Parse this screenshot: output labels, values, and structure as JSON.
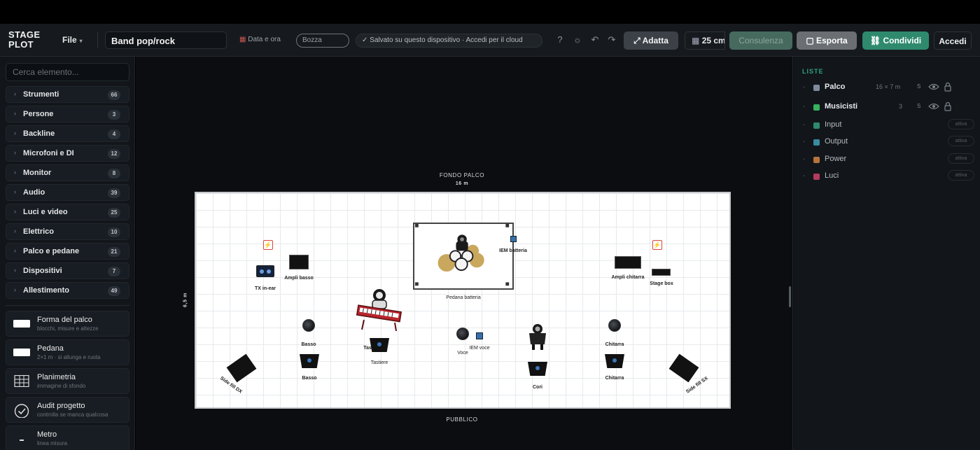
{
  "app": {
    "brand": "STAGE\nPLOT",
    "file_menu": "File",
    "project_name": "Band pop/rock"
  },
  "toolbar": {
    "date_label": "Data e ora",
    "status_draft": "Bozza",
    "saved_note": "Salvato su questo dispositivo · Accedi per il cloud",
    "fit_label": "Adatta",
    "grid_label": "25 cm",
    "consult_label": "Consulenza",
    "export_label": "Esporta",
    "share_label": "Condividi",
    "login_label": "Accedi"
  },
  "sidebar": {
    "search_placeholder": "Cerca elemento...",
    "categories": [
      {
        "label": "Strumenti",
        "count": "66"
      },
      {
        "label": "Persone",
        "count": "3"
      },
      {
        "label": "Backline",
        "count": "4"
      },
      {
        "label": "Microfoni e DI",
        "count": "12"
      },
      {
        "label": "Monitor",
        "count": "8"
      },
      {
        "label": "Audio",
        "count": "39"
      },
      {
        "label": "Luci e video",
        "count": "25"
      },
      {
        "label": "Elettrico",
        "count": "10"
      },
      {
        "label": "Palco e pedane",
        "count": "21"
      },
      {
        "label": "Dispositivi",
        "count": "7"
      },
      {
        "label": "Allestimento",
        "count": "49"
      }
    ],
    "tools": [
      {
        "name": "Forma del palco",
        "sub": "blocchi, misure e altezze"
      },
      {
        "name": "Pedana",
        "sub": "2×1 m · si allunga e ruota"
      },
      {
        "name": "Planimetria",
        "sub": "immagine di sfondo"
      },
      {
        "name": "Audit progetto",
        "sub": "controlla se manca qualcosa"
      },
      {
        "name": "Metro",
        "sub": "linea misura"
      }
    ]
  },
  "stage": {
    "back_label": "FONDO PALCO",
    "width_label": "16 m",
    "depth_label": "6,5 m",
    "front_label": "PUBBLICO",
    "items": {
      "drum_riser": "Pedana batteria",
      "iem_drums": "IEM batteria",
      "tx_inear": "TX in-ear",
      "bass_amp": "Ampli basso",
      "guitar_amp": "Ampli chitarra",
      "stage_box": "Stage box",
      "mic_bass": "Basso",
      "mon_bass": "Basso",
      "keys_label": "Tastiere",
      "keys_partial": "Tas",
      "mic_voice": "Voce",
      "iem_voice": "IEM voce",
      "mon_cori": "Cori",
      "mic_guitar": "Chitarra",
      "mon_guitar": "Chitarra",
      "side_dx": "Side fill DX",
      "side_sx": "Side fill SX"
    }
  },
  "layers": {
    "title": "LISTE",
    "items": [
      {
        "name": "Palco",
        "meta": "16 × 7 m",
        "s": "S",
        "color": "#7f8a9a",
        "active": ""
      },
      {
        "name": "Musicisti",
        "meta": "3",
        "s": "S",
        "color": "#35b35e",
        "active": ""
      },
      {
        "name": "Input",
        "color": "#2e8a6b",
        "active": "attiva"
      },
      {
        "name": "Output",
        "color": "#3a8aa0",
        "active": "attiva"
      },
      {
        "name": "Power",
        "color": "#b8733a",
        "active": "attiva"
      },
      {
        "name": "Luci",
        "color": "#b53a5e",
        "active": "attiva"
      }
    ]
  }
}
